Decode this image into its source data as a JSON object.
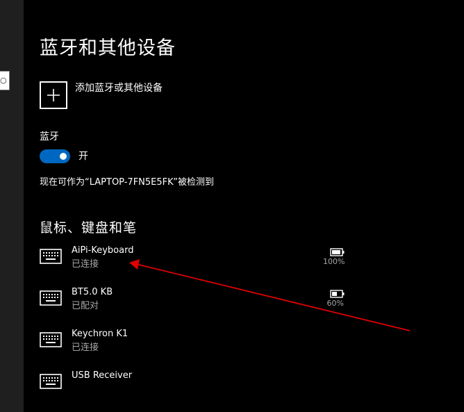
{
  "page": {
    "title": "蓝牙和其他设备"
  },
  "add_device": {
    "label": "添加蓝牙或其他设备"
  },
  "bluetooth": {
    "label": "蓝牙",
    "toggle_state": "开",
    "on": true
  },
  "discoverable_text": "现在可作为“LAPTOP-7FN5E5FK”被检测到",
  "section": {
    "title": "鼠标、键盘和笔"
  },
  "devices": [
    {
      "name": "AiPi-Keyboard",
      "status": "已连接",
      "battery": "100%",
      "battery_level": 1.0
    },
    {
      "name": "BT5.0 KB",
      "status": "已配对",
      "battery": "60%",
      "battery_level": 0.6
    },
    {
      "name": "Keychron K1",
      "status": "已连接"
    },
    {
      "name": "USB Receiver",
      "status": ""
    }
  ],
  "colors": {
    "accent": "#0067c0",
    "annotation_arrow": "#e00000",
    "secondary_text": "#a6a6a6"
  },
  "icons": {
    "add": "plus-icon",
    "device": "keyboard-icon",
    "battery": "battery-icon",
    "search": "search-icon"
  }
}
